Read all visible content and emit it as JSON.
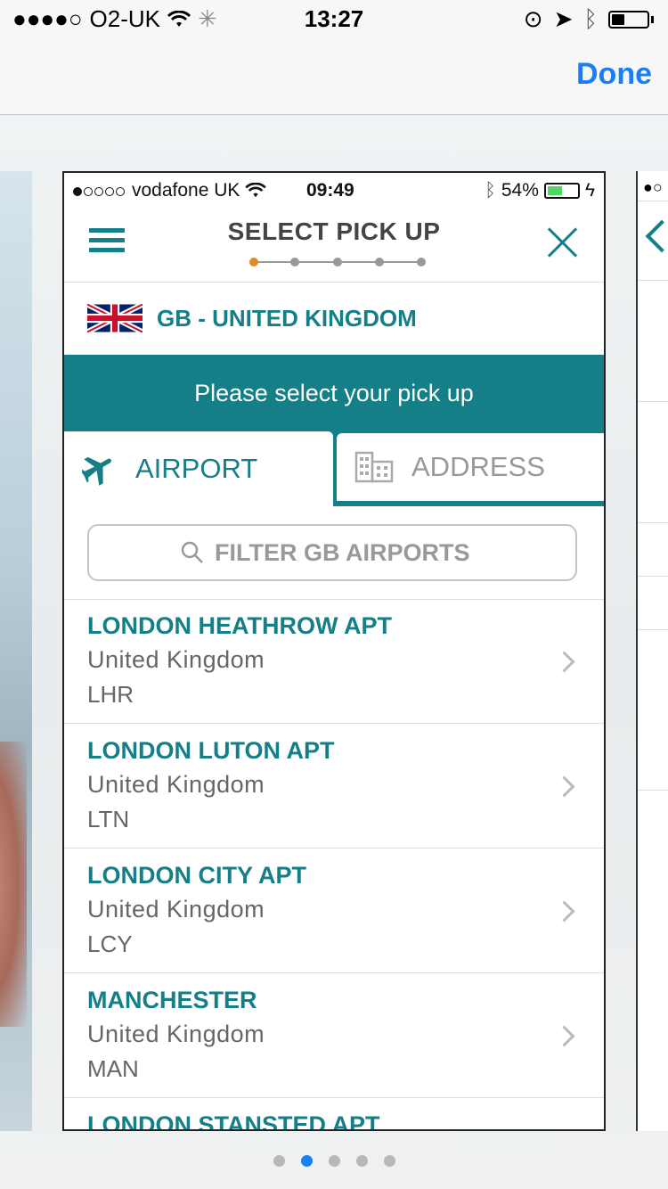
{
  "os_status": {
    "carrier": "O2-UK",
    "time": "13:27"
  },
  "os_nav": {
    "done_label": "Done"
  },
  "app_status": {
    "carrier": "vodafone UK",
    "time": "09:49",
    "battery": "54%"
  },
  "header": {
    "title": "SELECT PICK UP",
    "step_count": 5,
    "active_step": 1
  },
  "country": {
    "label": "GB - UNITED KINGDOM"
  },
  "banner": {
    "text": "Please select your pick up"
  },
  "tabs": {
    "airport": "AIRPORT",
    "address": "ADDRESS"
  },
  "filter": {
    "placeholder": "FILTER GB AIRPORTS"
  },
  "airports": [
    {
      "name": "LONDON HEATHROW APT",
      "country": "United Kingdom",
      "code": "LHR"
    },
    {
      "name": "LONDON LUTON APT",
      "country": "United Kingdom",
      "code": "LTN"
    },
    {
      "name": "LONDON CITY APT",
      "country": "United Kingdom",
      "code": "LCY"
    },
    {
      "name": "MANCHESTER",
      "country": "United Kingdom",
      "code": "MAN"
    },
    {
      "name": "LONDON STANSTED APT"
    }
  ],
  "pager": {
    "count": 5,
    "active": 2
  },
  "colors": {
    "accent": "#147f86",
    "ios_blue": "#1a7ef5",
    "step_active": "#e08a2a"
  }
}
